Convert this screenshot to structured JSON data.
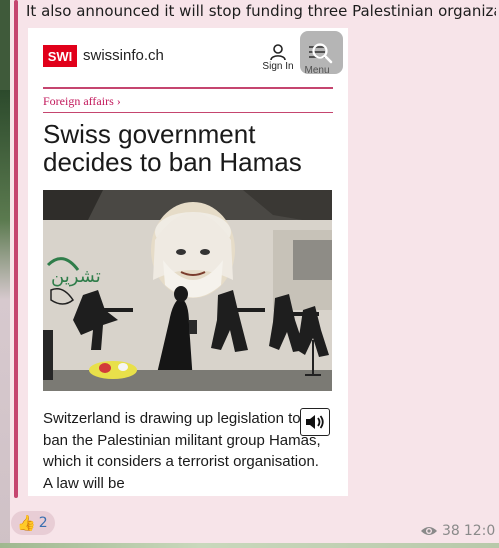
{
  "message": {
    "headline": "It also announced it will stop funding three Palestinian organiza...",
    "reaction": {
      "emoji": "👍",
      "count": "2"
    },
    "views": "38",
    "time": "12:0"
  },
  "preview": {
    "brand_logo": "SWI",
    "brand_domain": "swissinfo.ch",
    "signin_label": "Sign In",
    "menu_label": "Menu",
    "category": "Foreign affairs ›",
    "title": "Swiss government decides to ban Hamas",
    "excerpt": "Switzerland is drawing up legislation to ban the Palestinian militant group Hamas, which it considers a terrorist organisation. A law will be",
    "photo_graffiti_text": "تشرين"
  },
  "colors": {
    "accent": "#c5456f",
    "brand_red": "#e1001a",
    "category": "#c2185b",
    "bubble_bg": "#f7e4e9",
    "count_blue": "#3a6fb0"
  }
}
